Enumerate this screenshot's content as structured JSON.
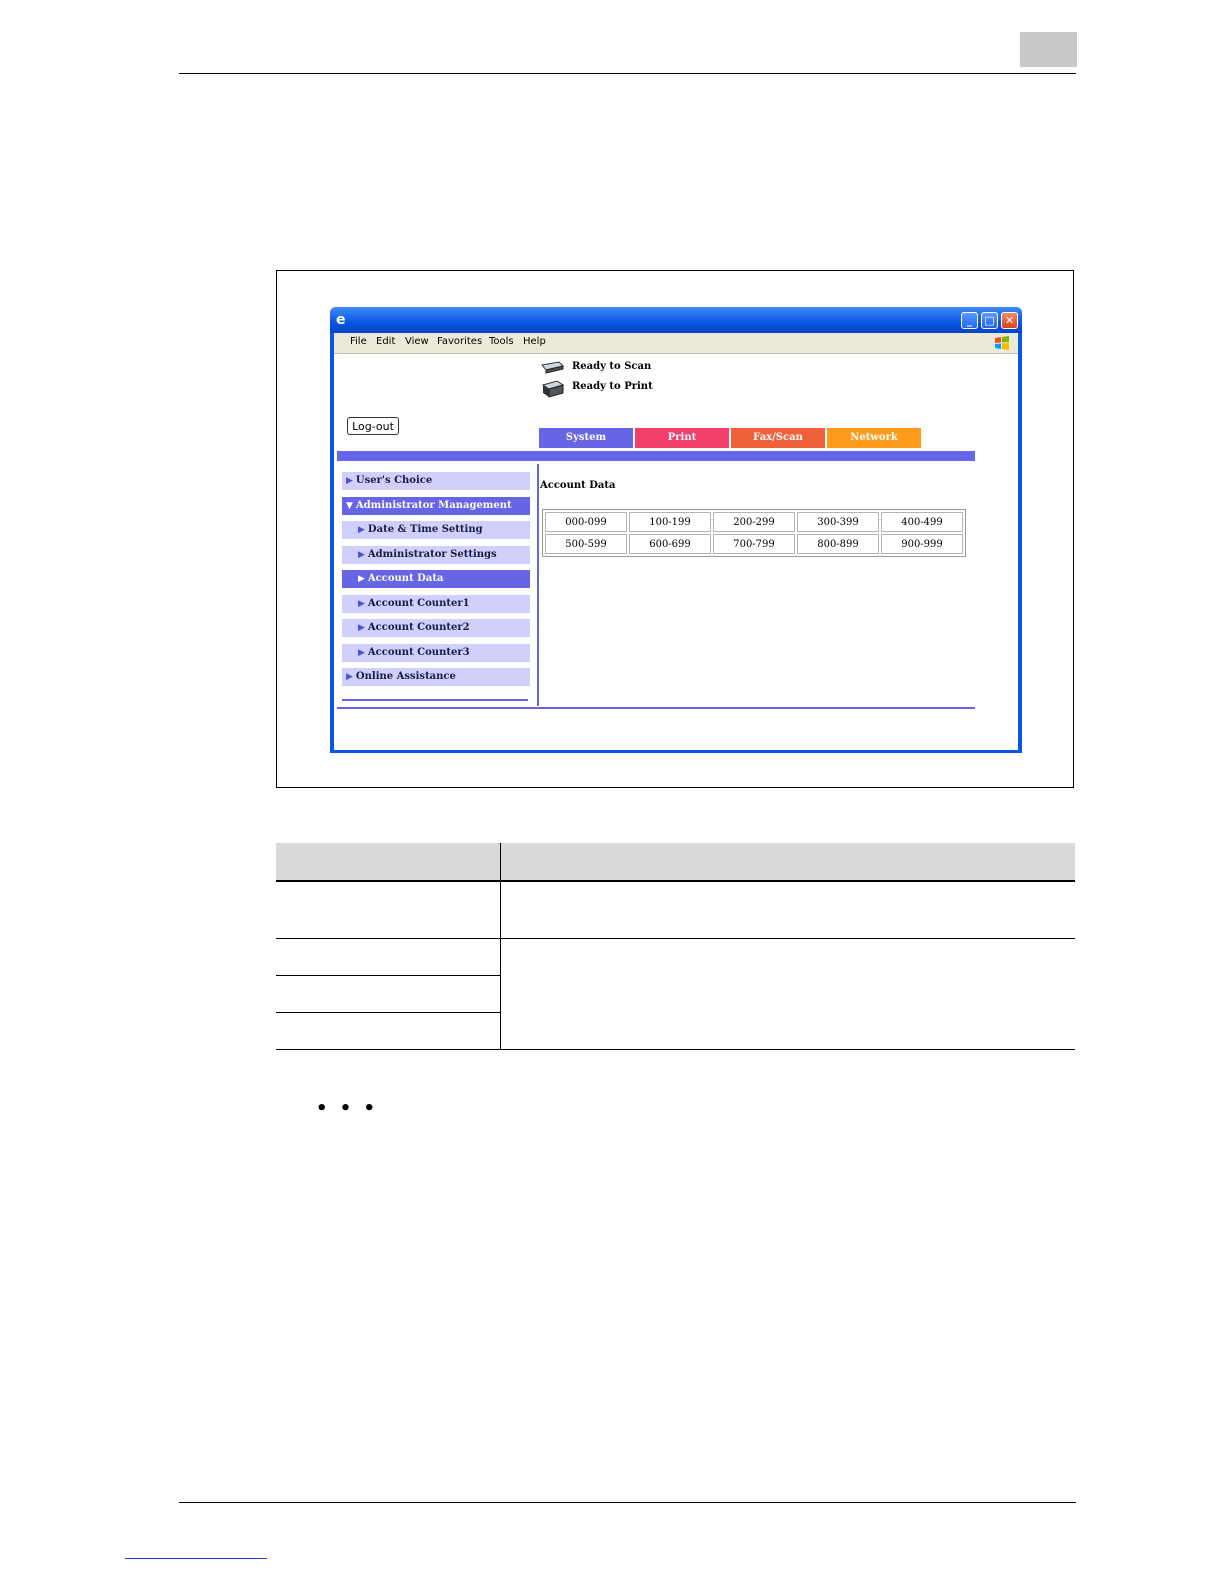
{
  "browser": {
    "menu": [
      "File",
      "Edit",
      "View",
      "Favorites",
      "Tools",
      "Help"
    ],
    "status": [
      "Ready to Scan",
      "Ready to Print"
    ],
    "logout_label": "Log-out",
    "tabs": [
      {
        "label": "System",
        "color": "#6565e6"
      },
      {
        "label": "Print",
        "color": "#ef3f6a"
      },
      {
        "label": "Fax/Scan",
        "color": "#f0603a"
      },
      {
        "label": "Network",
        "color": "#ff9a1a"
      }
    ],
    "sidebar": [
      {
        "label": "User's Choice",
        "level": 0,
        "arrow": "▶",
        "active": false
      },
      {
        "label": "Administrator Management",
        "level": 0,
        "arrow": "▼",
        "active": true
      },
      {
        "label": "Date & Time Setting",
        "level": 1,
        "arrow": "▶",
        "active": false
      },
      {
        "label": "Administrator Settings",
        "level": 1,
        "arrow": "▶",
        "active": false
      },
      {
        "label": "Account Data",
        "level": 1,
        "arrow": "▶",
        "active": true
      },
      {
        "label": "Account Counter1",
        "level": 1,
        "arrow": "▶",
        "active": false
      },
      {
        "label": "Account Counter2",
        "level": 1,
        "arrow": "▶",
        "active": false
      },
      {
        "label": "Account Counter3",
        "level": 1,
        "arrow": "▶",
        "active": false
      },
      {
        "label": "Online Assistance",
        "level": 0,
        "arrow": "▶",
        "active": false
      }
    ],
    "content": {
      "title": "Account Data",
      "ranges": [
        [
          "000-099",
          "100-199",
          "200-299",
          "300-399",
          "400-499"
        ],
        [
          "500-599",
          "600-699",
          "700-799",
          "800-899",
          "900-999"
        ]
      ]
    }
  },
  "ellipsis": "• • •"
}
